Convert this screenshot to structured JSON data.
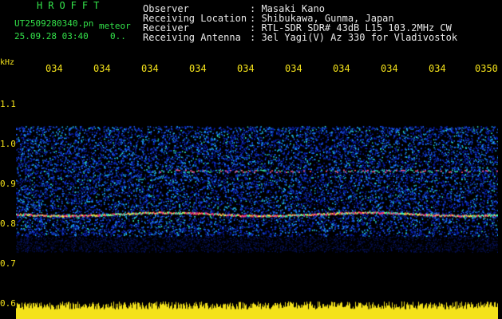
{
  "header": {
    "station": "HROFFT",
    "filename": "UT2509280340.pn",
    "tag": "meteor",
    "datetime": "25.09.28 03:40",
    "count": "0.."
  },
  "meta": {
    "rows": [
      {
        "key": "Observer",
        "value": ": Masaki Kano"
      },
      {
        "key": "Receiving Location",
        "value": ": Shibukawa, Gunma, Japan"
      },
      {
        "key": "Receiver",
        "value": ": RTL-SDR SDR# 43dB L15 103.2MHz CW"
      },
      {
        "key": "Receiving Antenna",
        "value": ": 3el Yagi(V) Az 330 for Vladivostok"
      }
    ]
  },
  "axes": {
    "y_unit": "kHz",
    "y_ticks": [
      "1.1",
      "1.0",
      "0.9",
      "0.8",
      "0.7",
      "0.6"
    ],
    "x_ticks": [
      "034",
      "034",
      "034",
      "034",
      "034",
      "034",
      "034",
      "034",
      "034",
      "0350"
    ]
  },
  "colors": {
    "background": "#000000",
    "header_green": "#33e24a",
    "label_yellow": "#f4e21a",
    "meta_white": "#e8e8e8"
  }
}
